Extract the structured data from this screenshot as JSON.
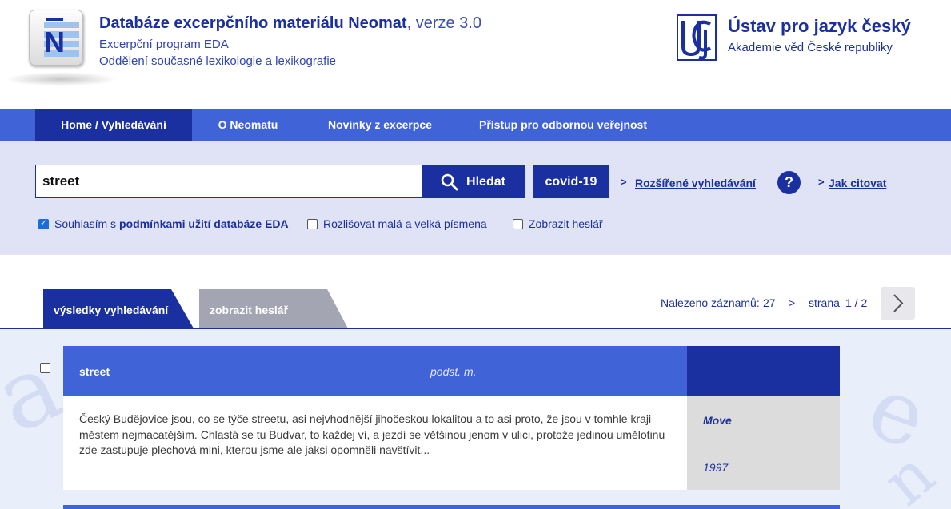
{
  "header": {
    "title_bold": "Databáze excerpčního materiálu Neomat",
    "title_version": ", verze 3.0",
    "subtitle1": "Excerpční program EDA",
    "subtitle2": "Oddělení současné lexikologie a lexikografie",
    "logo_icon": "neomat-logo-icon",
    "institute_name": "Ústav pro jazyk český",
    "institute_sub": "Akademie věd České republiky",
    "institute_logo_icon": "ujc-logo-icon"
  },
  "nav": {
    "items": [
      {
        "label": "Home / Vyhledávání",
        "active": true
      },
      {
        "label": "O Neomatu",
        "active": false
      },
      {
        "label": "Novinky z excerpce",
        "active": false
      },
      {
        "label": "Přístup pro odbornou veřejnost",
        "active": false
      }
    ]
  },
  "search": {
    "query": "street",
    "button_label": "Hledat",
    "covid_label": "covid-19",
    "advanced_link": "Rozšířené vyhledávání",
    "help_label": "?",
    "cite_link": "Jak citovat",
    "arrow": ">",
    "consent_text": "Souhlasím s",
    "consent_link": "podmínkami užití databáze EDA",
    "consent_checked": true,
    "case_label": "Rozlišovat malá a velká písmena",
    "case_checked": false,
    "lemma_label": "Zobrazit heslář",
    "lemma_checked": false
  },
  "tabs": {
    "active": "výsledky vyhledávání",
    "inactive": "zobrazit heslář"
  },
  "results_info": {
    "found_label": "Nalezeno záznamů:",
    "found_count": "27",
    "separator": ">",
    "page_label": "strana",
    "page_value": "1 / 2",
    "next_icon": "chevron-right-icon"
  },
  "entries": [
    {
      "word": "street",
      "pos": "podst. m.",
      "text": "Český Budějovice jsou, co se týče streetu, asi nejvhodnější jihočeskou lokalitou a to asi proto, že jsou v tomhle kraji městem nejmacatějším. Chlastá se tu Budvar, to každej ví, a jezdí se většinou jenom v ulici, protože jedinou umělotinu zde zastupuje plechová mini, kterou jsme ale jaksi opomněli navštívit...",
      "source": "Move",
      "year": "1997"
    }
  ],
  "colors": {
    "primary": "#1a2fa0",
    "nav": "#4163d8",
    "panel": "#dfe3f5",
    "tab_inactive": "#a4a5b3"
  }
}
